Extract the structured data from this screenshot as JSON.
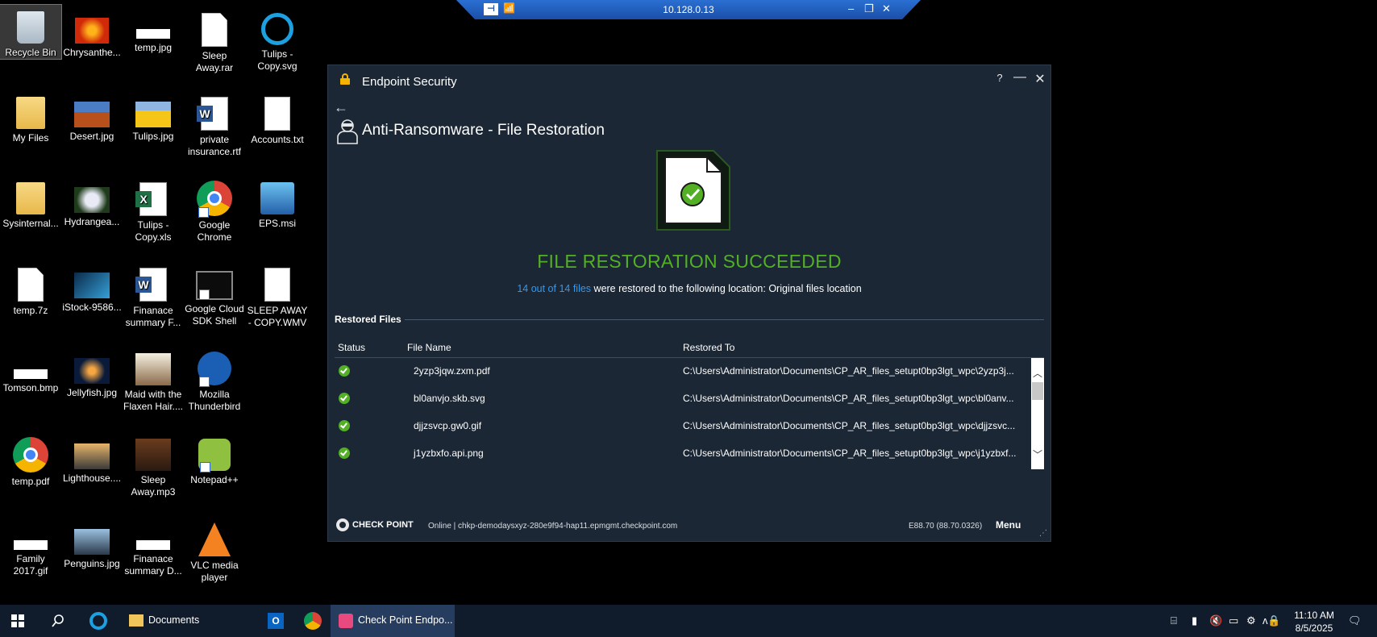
{
  "desktop": {
    "icons": [
      {
        "label": "Recycle Bin"
      },
      {
        "label": "Chrysanthe..."
      },
      {
        "label": "temp.jpg"
      },
      {
        "label": "Sleep Away.rar"
      },
      {
        "label": "Tulips - Copy.svg"
      },
      {
        "label": "My Files"
      },
      {
        "label": "Desert.jpg"
      },
      {
        "label": "Tulips.jpg"
      },
      {
        "label": "private insurance.rtf"
      },
      {
        "label": "Accounts.txt"
      },
      {
        "label": "Sysinternal..."
      },
      {
        "label": "Hydrangea..."
      },
      {
        "label": "Tulips - Copy.xls"
      },
      {
        "label": "Google Chrome"
      },
      {
        "label": "EPS.msi"
      },
      {
        "label": "temp.7z"
      },
      {
        "label": "iStock-9586..."
      },
      {
        "label": "Finanace summary F..."
      },
      {
        "label": "Google Cloud SDK Shell"
      },
      {
        "label": "SLEEP AWAY - COPY.WMV"
      },
      {
        "label": "Tomson.bmp"
      },
      {
        "label": "Jellyfish.jpg"
      },
      {
        "label": "Maid with the Flaxen Hair...."
      },
      {
        "label": "Mozilla Thunderbird"
      },
      {
        "label": "temp.pdf"
      },
      {
        "label": "Lighthouse...."
      },
      {
        "label": "Sleep Away.mp3"
      },
      {
        "label": "Notepad++"
      },
      {
        "label": "Family 2017.gif"
      },
      {
        "label": "Penguins.jpg"
      },
      {
        "label": "Finanace summary D..."
      },
      {
        "label": "VLC media player"
      }
    ]
  },
  "remote_bar": {
    "ip": "10.128.0.13",
    "pin_label": "⊣"
  },
  "window": {
    "title": "Endpoint Security",
    "help_label": "?",
    "minimize_label": "—",
    "close_label": "✕",
    "back_label": "←",
    "page_title": "Anti-Ransomware - File Restoration",
    "success_title": "FILE RESTORATION SUCCEEDED",
    "restore_count": "14 out of 14 files",
    "restore_text": " were restored to the following location:  Original files location",
    "section_title": "Restored Files",
    "columns": {
      "status": "Status",
      "file_name": "File Name",
      "restored_to": "Restored To"
    },
    "rows": [
      {
        "file": "2yzp3jqw.zxm.pdf",
        "path": "C:\\Users\\Administrator\\Documents\\CP_AR_files_setupt0bp3lgt_wpc\\2yzp3j..."
      },
      {
        "file": "bl0anvjo.skb.svg",
        "path": "C:\\Users\\Administrator\\Documents\\CP_AR_files_setupt0bp3lgt_wpc\\bl0anv..."
      },
      {
        "file": "djjzsvcp.gw0.gif",
        "path": "C:\\Users\\Administrator\\Documents\\CP_AR_files_setupt0bp3lgt_wpc\\djjzsvc..."
      },
      {
        "file": "j1yzbxfo.api.png",
        "path": "C:\\Users\\Administrator\\Documents\\CP_AR_files_setupt0bp3lgt_wpc\\j1yzbxf..."
      }
    ],
    "footer": {
      "brand": "CHECK POINT",
      "status": "Online  |  chkp-demodaysxyz-280e9f94-hap11.epmgmt.checkpoint.com",
      "version": "E88.70  (88.70.0326)",
      "menu_label": "Menu"
    },
    "colors": {
      "background": "#1b2735",
      "success_green": "#53b025",
      "link_blue": "#2e9bef"
    }
  },
  "taskbar": {
    "documents_label": "Documents",
    "checkpoint_label": "Check Point Endpo...",
    "time": "11:10 AM",
    "date": "8/5/2025"
  }
}
